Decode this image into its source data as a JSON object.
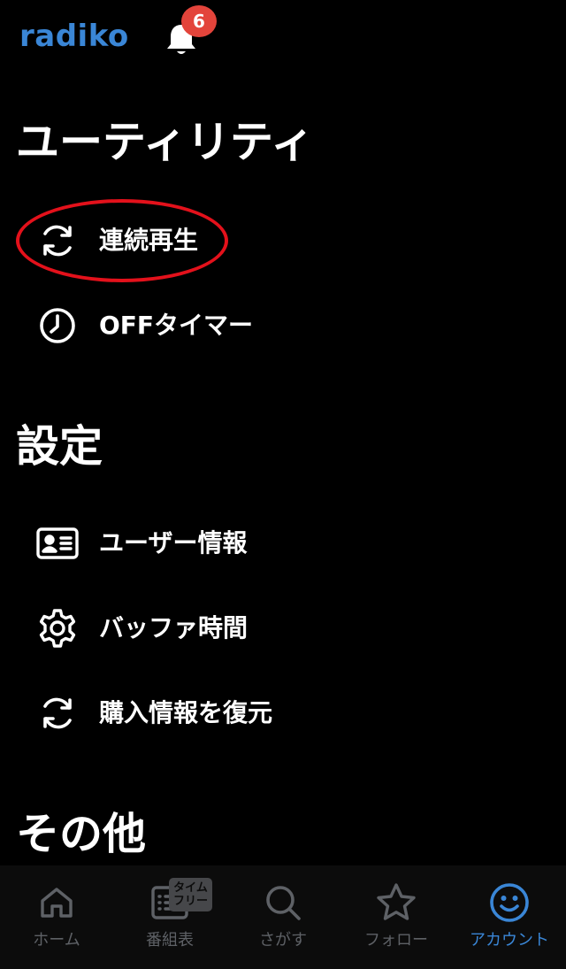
{
  "colors": {
    "background": "#000000",
    "text": "#ffffff",
    "brand_blue": "#3a86d6",
    "badge_red": "#e3443b",
    "highlight_red": "#e3111b",
    "tab_inactive": "#5e6166",
    "tab_active": "#3a86d6"
  },
  "header": {
    "logo_text": "radiko",
    "notification_icon": "bell-icon",
    "notification_count": "6"
  },
  "sections": {
    "utility": {
      "title": "ユーティリティ",
      "items": [
        {
          "label": "連続再生",
          "icon": "repeat-icon"
        },
        {
          "label": "OFFタイマー",
          "icon": "timer-icon"
        }
      ]
    },
    "settings": {
      "title": "設定",
      "items": [
        {
          "label": "ユーザー情報",
          "icon": "id-card-icon"
        },
        {
          "label": "バッファ時間",
          "icon": "gear-icon"
        },
        {
          "label": "購入情報を復元",
          "icon": "refresh-icon"
        }
      ]
    },
    "other": {
      "title": "その他"
    }
  },
  "tabbar": {
    "tabs": [
      {
        "label": "ホーム",
        "icon": "home-icon",
        "active": false
      },
      {
        "label": "番組表",
        "icon": "program-guide-icon",
        "active": false
      },
      {
        "label": "さがす",
        "icon": "search-icon",
        "active": false
      },
      {
        "label": "フォロー",
        "icon": "star-icon",
        "active": false
      },
      {
        "label": "アカウント",
        "icon": "smiley-icon",
        "active": true
      }
    ],
    "timefree_badge": [
      "タイム",
      "フリー"
    ]
  }
}
